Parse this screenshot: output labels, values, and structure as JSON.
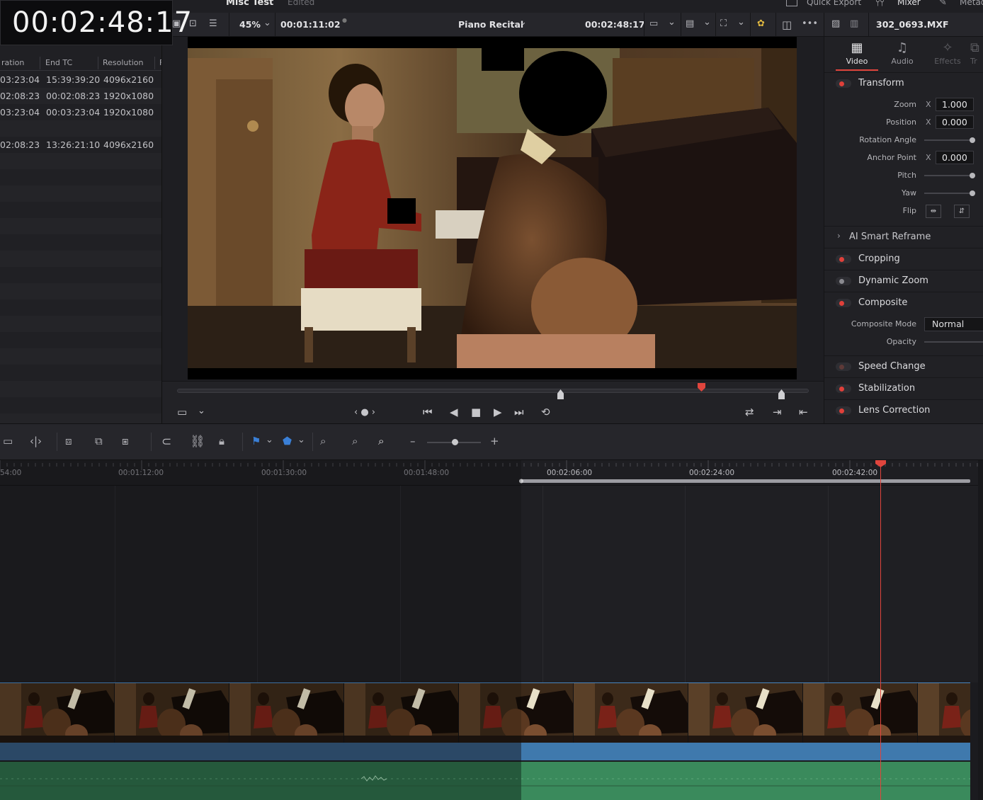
{
  "big_timecode": "00:02:48:17",
  "app": {
    "project_name": "Misc Test",
    "status": "Edited",
    "quick_export": "Quick Export",
    "mixer": "Mixer",
    "metadata": "Metad"
  },
  "media_pool": {
    "columns": [
      "ration",
      "End TC",
      "Resolution",
      "F"
    ],
    "rows": [
      {
        "duration": "03:23:04",
        "end_tc": "15:39:39:20",
        "resolution": "4096x2160"
      },
      {
        "duration": "02:08:23",
        "end_tc": "00:02:08:23",
        "resolution": "1920x1080"
      },
      {
        "duration": "03:23:04",
        "end_tc": "00:03:23:04",
        "resolution": "1920x1080"
      },
      {
        "duration": "",
        "end_tc": "",
        "resolution": ""
      },
      {
        "duration": "02:08:23",
        "end_tc": "13:26:21:10",
        "resolution": "4096x2160"
      }
    ]
  },
  "viewer": {
    "zoom": "45%",
    "source_timecode": "00:01:11:02",
    "timeline_name": "Piano Recital",
    "record_timecode": "00:02:48:17",
    "transport_nav": "‹ ● ›"
  },
  "inspector": {
    "clip_name": "302_0693.MXF",
    "tabs": [
      {
        "label": "Video",
        "icon": "film-icon",
        "active": true
      },
      {
        "label": "Audio",
        "icon": "music-note-icon",
        "active": false
      },
      {
        "label": "Effects",
        "icon": "magic-wand-icon",
        "active": false
      },
      {
        "label": "Tr",
        "icon": "transition-icon",
        "active": false
      }
    ],
    "transform": {
      "title": "Transform",
      "zoom_label": "Zoom",
      "zoom_axis": "X",
      "zoom_value": "1.000",
      "position_label": "Position",
      "position_axis": "X",
      "position_value": "0.000",
      "rotation_label": "Rotation Angle",
      "anchor_label": "Anchor Point",
      "anchor_axis": "X",
      "anchor_value": "0.000",
      "pitch_label": "Pitch",
      "yaw_label": "Yaw",
      "flip_label": "Flip"
    },
    "smart_reframe": "AI Smart Reframe",
    "sections": [
      {
        "label": "Cropping",
        "enabled": true
      },
      {
        "label": "Dynamic Zoom",
        "enabled": false
      },
      {
        "label": "Composite",
        "enabled": true
      }
    ],
    "composite": {
      "mode_label": "Composite Mode",
      "mode_value": "Normal",
      "opacity_label": "Opacity"
    },
    "lower_sections": [
      {
        "label": "Speed Change",
        "enabled": false
      },
      {
        "label": "Stabilization",
        "enabled": true
      },
      {
        "label": "Lens Correction",
        "enabled": true
      }
    ]
  },
  "timeline": {
    "ruler_labels": [
      "54:00",
      "00:01:12:00",
      "00:01:30:00",
      "00:01:48:00",
      "00:02:06:00",
      "00:02:24:00",
      "00:02:42:00"
    ],
    "playhead_timecode": "00:02:48:17"
  },
  "colors": {
    "accent_red": "#e0453d",
    "clip_blue": "#3f79ad",
    "audio_green": "#3a8a5c"
  }
}
